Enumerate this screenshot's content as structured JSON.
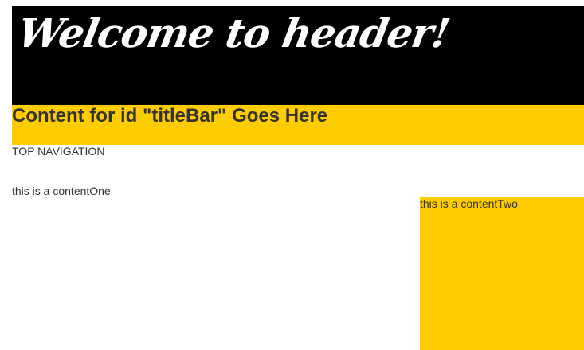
{
  "header": {
    "title": "Welcome to header!"
  },
  "title_bar": {
    "text": "Content for id \"titleBar\" Goes Here"
  },
  "top_navigation": {
    "label": "TOP NAVIGATION"
  },
  "content_one": {
    "text": "this is a contentOne"
  },
  "content_two": {
    "text": "this is a contentTwo"
  },
  "colors": {
    "header_background": "#000000",
    "header_text": "#ffffff",
    "accent_yellow": "#ffcc00",
    "body_text": "#333333",
    "page_background": "#ffffff"
  }
}
